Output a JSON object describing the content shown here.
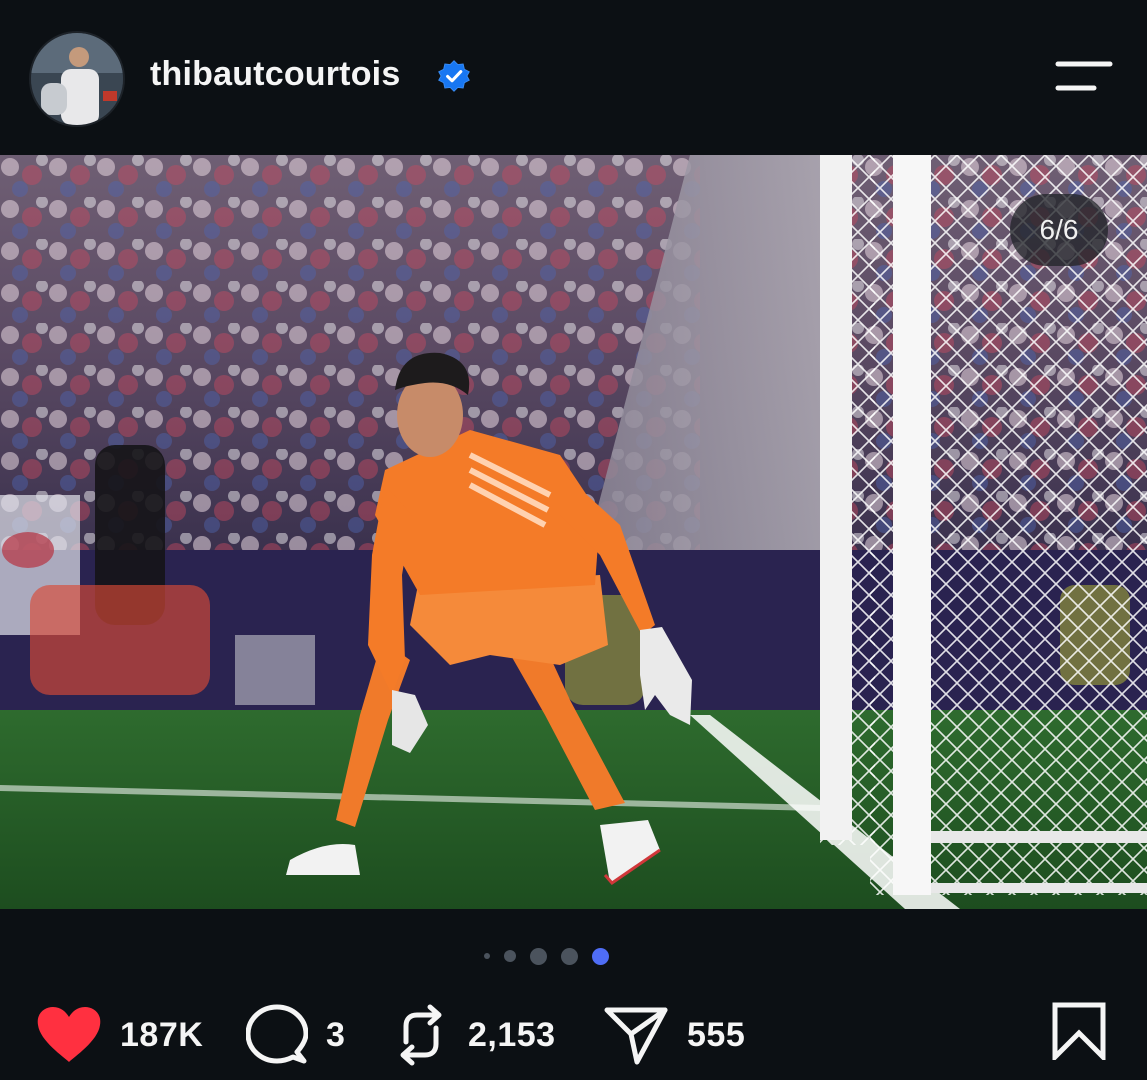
{
  "header": {
    "username": "thibautcourtois",
    "verified": true,
    "avatar_icon": "profile-avatar",
    "menu_icon": "menu-icon"
  },
  "post": {
    "image_counter": "6/6",
    "carousel": {
      "total": 6,
      "visible_dots": 5,
      "active_index": 4
    }
  },
  "actions": {
    "likes": "187K",
    "comments": "3",
    "reposts": "2,153",
    "shares": "555",
    "like_color": "#ff3040",
    "accent": "#4f6df5"
  }
}
